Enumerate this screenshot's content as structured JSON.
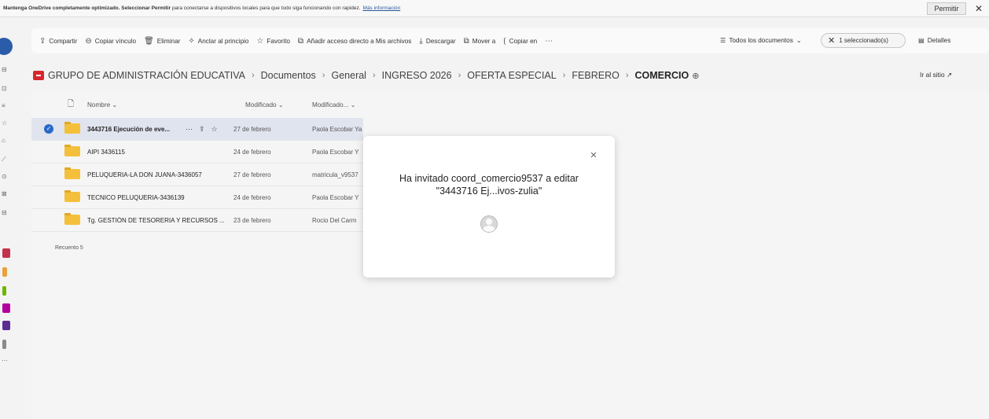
{
  "notification": {
    "message_prefix": "Mantenga OneDrive completamente optimizado. Seleccionar ",
    "message_bold": "Permitir",
    "message_suffix": " para conectarse a dispositivos locales para que todo siga funcionando con rapidez.",
    "link": "Más información",
    "permit_button": "Permitir",
    "close_icon": "✕"
  },
  "commandbar": {
    "items": [
      {
        "icon": "⇪",
        "label": "Compartir"
      },
      {
        "icon": "⊖",
        "label": "Copiar vínculo"
      },
      {
        "icon": "🗑",
        "label": "Eliminar"
      },
      {
        "icon": "✧",
        "label": "Anclar al principio"
      },
      {
        "icon": "☆",
        "label": "Favorito"
      },
      {
        "icon": "⧉",
        "label": "Añadir acceso directo a Mis archivos"
      },
      {
        "icon": "⤓",
        "label": "Descargar"
      },
      {
        "icon": "⧉",
        "label": "Mover a"
      },
      {
        "icon": "⟮",
        "label": "Copiar en"
      },
      {
        "icon": "⋯",
        "label": ""
      }
    ],
    "view_icon": "☰",
    "view_label": "Todos los documentos",
    "view_chevron": "⌄",
    "selection_close": "✕",
    "selection_label": "1 seleccionado(s)",
    "details_icon": "▤",
    "details_label": "Detalles"
  },
  "breadcrumb": {
    "items": [
      "GRUPO DE ADMINISTRACIÓN EDUCATIVA",
      "Documentos",
      "General",
      "INGRESO 2026",
      "OFERTA ESPECIAL",
      "FEBRERO"
    ],
    "current": "COMERCIO",
    "separator": "›",
    "globe": "⊕",
    "go_site": "Ir al sitio ↗"
  },
  "list": {
    "headers": {
      "file_icon": "🗋",
      "name": "Nombre",
      "modified": "Modificado",
      "modified_by": "Modificado...",
      "sort_icon": "⌄"
    },
    "rows": [
      {
        "name": "3443716 Ejecución de eve...",
        "modified": "27 de febrero",
        "modified_by": "Paola Escobar Ya",
        "selected": true
      },
      {
        "name": "AIPI 3436115",
        "modified": "24 de febrero",
        "modified_by": "Paola Escobar Y",
        "selected": false
      },
      {
        "name": "PELUQUERIA-LA DON JUANA-3436057",
        "modified": "27 de febrero",
        "modified_by": "matricula_v9537",
        "selected": false
      },
      {
        "name": "TECNICO PELUQUERIA-3436139",
        "modified": "24 de febrero",
        "modified_by": "Paola Escobar Y",
        "selected": false
      },
      {
        "name": "Tg. GESTIÓN DE TESORERIA Y RECURSOS ...",
        "modified": "23 de febrero",
        "modified_by": "Rocio Del Carm",
        "selected": false
      }
    ],
    "row_actions": {
      "more": "⋯",
      "share": "⇪",
      "favorite": "☆"
    },
    "check": "✓",
    "count": "Recuento 5"
  },
  "modal": {
    "close_icon": "✕",
    "line1": "Ha invitado coord_comercio9537 a editar",
    "line2": "\"3443716 Ej...ivos-zulia\""
  },
  "colors": {
    "accent": "#2a68c9",
    "site_red": "#d6272d",
    "folder": "#f4c03c"
  }
}
